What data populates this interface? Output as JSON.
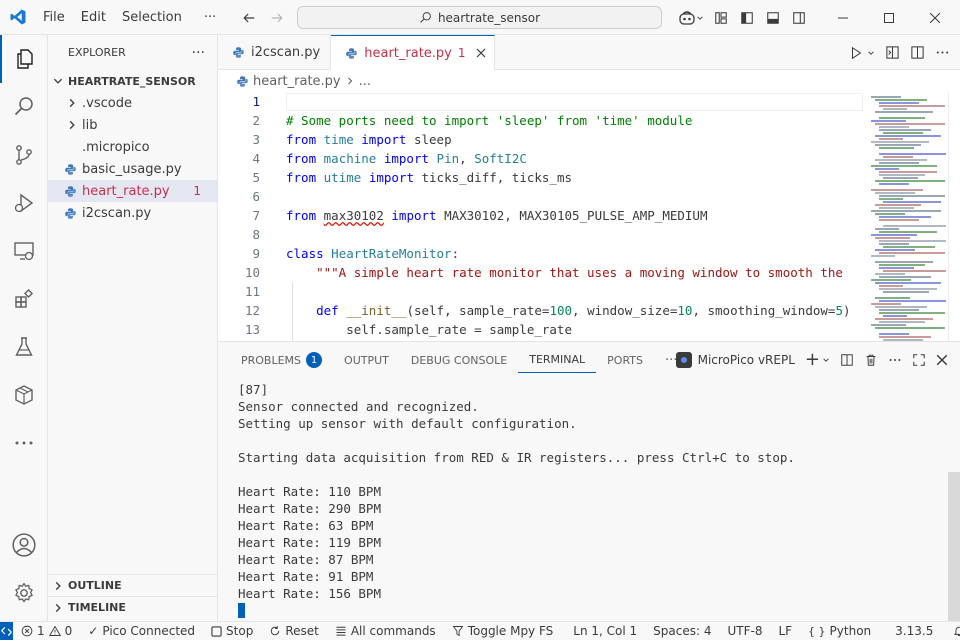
{
  "menu": {
    "file": "File",
    "edit": "Edit",
    "selection": "Selection",
    "more": "···"
  },
  "command_center": {
    "text": "heartrate_sensor"
  },
  "sidebar": {
    "title": "EXPLORER",
    "more": "···",
    "folder": "HEARTRATE_SENSOR",
    "items": [
      {
        "label": ".vscode",
        "type": "folder"
      },
      {
        "label": "lib",
        "type": "folder"
      },
      {
        "label": ".micropico",
        "type": "file"
      },
      {
        "label": "basic_usage.py",
        "type": "python"
      },
      {
        "label": "heart_rate.py",
        "type": "python",
        "badge": "1"
      },
      {
        "label": "i2cscan.py",
        "type": "python"
      }
    ],
    "outline": "OUTLINE",
    "timeline": "TIMELINE"
  },
  "tabs": [
    {
      "label": "i2cscan.py",
      "active": false
    },
    {
      "label": "heart_rate.py",
      "active": true,
      "badge": "1"
    }
  ],
  "breadcrumb": {
    "file": "heart_rate.py",
    "more": "..."
  },
  "code_lines": [
    {
      "n": "1",
      "parts": []
    },
    {
      "n": "2",
      "parts": [
        {
          "c": "cm",
          "t": "# Some ports need to import 'sleep' from 'time' module"
        }
      ]
    },
    {
      "n": "3",
      "parts": [
        {
          "c": "kw",
          "t": "from"
        },
        {
          "c": "",
          "t": " "
        },
        {
          "c": "cls",
          "t": "time"
        },
        {
          "c": "",
          "t": " "
        },
        {
          "c": "kw",
          "t": "import"
        },
        {
          "c": "",
          "t": " sleep"
        }
      ]
    },
    {
      "n": "4",
      "parts": [
        {
          "c": "kw",
          "t": "from"
        },
        {
          "c": "",
          "t": " "
        },
        {
          "c": "cls",
          "t": "machine"
        },
        {
          "c": "",
          "t": " "
        },
        {
          "c": "kw",
          "t": "import"
        },
        {
          "c": "",
          "t": " "
        },
        {
          "c": "cls",
          "t": "Pin"
        },
        {
          "c": "",
          "t": ", "
        },
        {
          "c": "cls",
          "t": "SoftI2C"
        }
      ]
    },
    {
      "n": "5",
      "parts": [
        {
          "c": "kw",
          "t": "from"
        },
        {
          "c": "",
          "t": " "
        },
        {
          "c": "cls",
          "t": "utime"
        },
        {
          "c": "",
          "t": " "
        },
        {
          "c": "kw",
          "t": "import"
        },
        {
          "c": "",
          "t": " ticks_diff, ticks_ms"
        }
      ]
    },
    {
      "n": "6",
      "parts": []
    },
    {
      "n": "7",
      "parts": [
        {
          "c": "kw",
          "t": "from"
        },
        {
          "c": "",
          "t": " "
        },
        {
          "c": "squiggle",
          "t": "max30102"
        },
        {
          "c": "",
          "t": " "
        },
        {
          "c": "kw",
          "t": "import"
        },
        {
          "c": "",
          "t": " MAX30102, MAX30105_PULSE_AMP_MEDIUM"
        }
      ]
    },
    {
      "n": "8",
      "parts": []
    },
    {
      "n": "9",
      "parts": [
        {
          "c": "kw",
          "t": "class"
        },
        {
          "c": "",
          "t": " "
        },
        {
          "c": "cls",
          "t": "HeartRateMonitor"
        },
        {
          "c": "",
          "t": ":"
        }
      ]
    },
    {
      "n": "10",
      "parts": [
        {
          "c": "",
          "t": "    "
        },
        {
          "c": "str",
          "t": "\"\"\"A simple heart rate monitor that uses a moving window to smooth the"
        }
      ]
    },
    {
      "n": "11",
      "parts": []
    },
    {
      "n": "12",
      "parts": [
        {
          "c": "",
          "t": "    "
        },
        {
          "c": "kw",
          "t": "def"
        },
        {
          "c": "",
          "t": " "
        },
        {
          "c": "fn",
          "t": "__init__"
        },
        {
          "c": "",
          "t": "(self, sample_rate="
        },
        {
          "c": "num",
          "t": "100"
        },
        {
          "c": "",
          "t": ", window_size="
        },
        {
          "c": "num",
          "t": "10"
        },
        {
          "c": "",
          "t": ", smoothing_window="
        },
        {
          "c": "num",
          "t": "5"
        },
        {
          "c": "",
          "t": ")"
        }
      ]
    },
    {
      "n": "13",
      "parts": [
        {
          "c": "",
          "t": "        self.sample_rate = sample_rate"
        }
      ]
    }
  ],
  "panel": {
    "tabs": [
      {
        "label": "PROBLEMS",
        "badge": "1"
      },
      {
        "label": "OUTPUT"
      },
      {
        "label": "DEBUG CONSOLE"
      },
      {
        "label": "TERMINAL",
        "active": true
      },
      {
        "label": "PORTS"
      }
    ],
    "more": "···",
    "terminal_name": "MicroPico vREPL",
    "add": "+"
  },
  "terminal_lines": [
    "[87]",
    "Sensor connected and recognized.",
    "Setting up sensor with default configuration.",
    "",
    "Starting data acquisition from RED & IR registers... press Ctrl+C to stop.",
    "",
    "Heart Rate: 110 BPM",
    "Heart Rate: 290 BPM",
    "Heart Rate: 63 BPM",
    "Heart Rate: 119 BPM",
    "Heart Rate: 87 BPM",
    "Heart Rate: 91 BPM",
    "Heart Rate: 156 BPM"
  ],
  "status": {
    "errors": "1",
    "warnings": "0",
    "pico": "Pico Connected",
    "stop": "Stop",
    "reset": "Reset",
    "all_commands": "All commands",
    "toggle": "Toggle Mpy FS",
    "position": "Ln 1, Col 1",
    "spaces": "Spaces: 4",
    "encoding": "UTF-8",
    "eol": "LF",
    "language": "Python",
    "version": "3.13.5"
  },
  "colors": {
    "accent": "#005fb8",
    "error": "#c4314b"
  }
}
